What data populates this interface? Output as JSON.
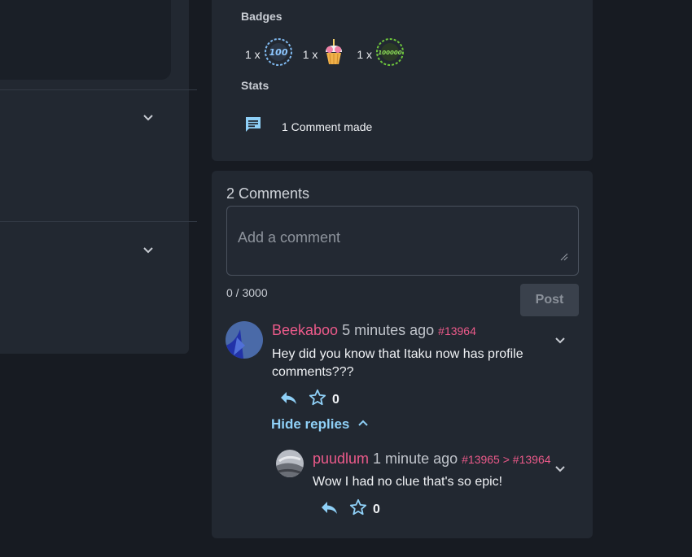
{
  "stats_card": {
    "badges_label": "Badges",
    "badges": [
      {
        "count": "1 x",
        "icon": "badge-100-laurel-icon",
        "color": "#5aa5e8"
      },
      {
        "count": "1 x",
        "icon": "badge-cupcake-icon",
        "color": "#f07fa6"
      },
      {
        "count": "1 x",
        "icon": "badge-100000-laurel-icon",
        "color": "#6cc43c"
      }
    ],
    "stats_label": "Stats",
    "stat": {
      "icon": "comment-icon",
      "text": "1 Comment made"
    }
  },
  "comments": {
    "title": "2 Comments",
    "input_placeholder": "Add a comment",
    "char_count": "0 / 3000",
    "post_label": "Post",
    "thread": [
      {
        "user": "Beekaboo",
        "time": "5 minutes ago",
        "id": "#13964",
        "body": "Hey did you know that Itaku now has profile comments???",
        "likes": "0",
        "hide_replies_label": "Hide replies",
        "replies": [
          {
            "user": "puudlum",
            "time": "1 minute ago",
            "id": "#13965 > #13964",
            "body": "Wow I had no clue that's so epic!",
            "likes": "0"
          }
        ]
      }
    ]
  },
  "colors": {
    "accent_pink": "#ec5a8a",
    "accent_blue": "#8fd0f7",
    "card": "#222831",
    "background": "#171b22"
  }
}
